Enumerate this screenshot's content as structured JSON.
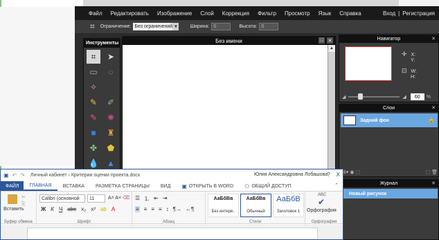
{
  "pixlr": {
    "menu": [
      "Файл",
      "Редактировать",
      "Изображение",
      "Слой",
      "Коррекция",
      "Фильтр",
      "Просмотр",
      "Язык",
      "Справка"
    ],
    "login": "Вход",
    "divider": "|",
    "register": "Регистрация",
    "options": {
      "constraint_label": "Ограничение:",
      "constraint_value": "Без ограничений",
      "width_label": "Ширина:",
      "width_value": "0",
      "height_label": "Высота:",
      "height_value": "0"
    },
    "tools_title": "Инструменты",
    "canvas_title": "Без имени",
    "navigator": {
      "title": "Навигатор",
      "x_label": "X:",
      "y_label": "Y:",
      "w_label": "W:",
      "h_label": "H:",
      "zoom_value": "60",
      "zoom_unit": "%"
    },
    "layers": {
      "title": "Слои",
      "items": [
        {
          "name": "Задний фон"
        }
      ]
    },
    "history": {
      "title": "Журнал",
      "items": [
        {
          "name": "Новый рисунок"
        }
      ]
    }
  },
  "word": {
    "breadcrumb": "Личный кабинет › Критерии оценки проекта.docx",
    "user": "Юлия Александровна Лобашова",
    "help": "?",
    "close": "X",
    "tabs": {
      "file": "ФАЙЛ",
      "home": "ГЛАВНАЯ",
      "insert": "ВСТАВКА",
      "layout": "РАЗМЕТКА СТРАНИЦЫ",
      "view": "ВИД",
      "open_word": "ОТКРЫТЬ В WORD",
      "share": "ОБЩИЙ ДОСТУП"
    },
    "ribbon": {
      "paste": "Вставить",
      "clipboard_group": "Буфер обмена",
      "font_name": "Calibri (основной",
      "font_size": "11",
      "font_group": "Шрифт",
      "paragraph_group": "Абзац",
      "styles": [
        {
          "sample": "АаБбВв",
          "name": "Без интерв.."
        },
        {
          "sample": "АаБбВв",
          "name": "Обычный"
        },
        {
          "sample": "АаБбВ",
          "name": "Заголовок 1"
        }
      ],
      "styles_group": "Стили",
      "spelling_abc": "ABC",
      "spelling": "Орфография",
      "spelling_group": "Орфография"
    }
  }
}
